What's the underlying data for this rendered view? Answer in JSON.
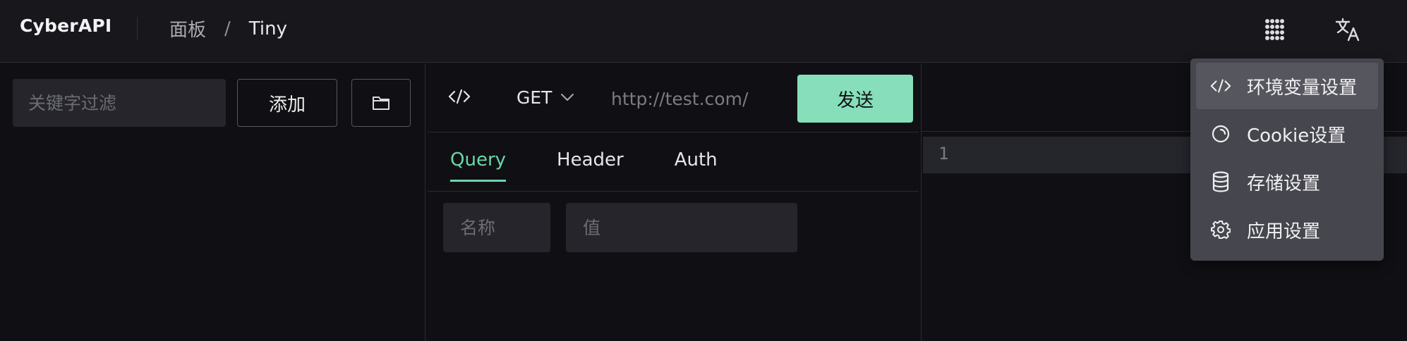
{
  "app": {
    "title": "CyberAPI"
  },
  "breadcrumb": {
    "items": [
      "面板",
      "Tiny"
    ],
    "separator": "/"
  },
  "topbar": {
    "apps_icon": "grid-apps-icon",
    "language_icon": "translate-icon"
  },
  "left": {
    "filter_placeholder": "关键字过滤",
    "add_label": "添加",
    "folder_icon": "folder-icon"
  },
  "request": {
    "code_icon": "code-icon",
    "method": "GET",
    "url_placeholder": "http://test.com/",
    "send_label": "发送",
    "tabs": [
      "Query",
      "Header",
      "Auth"
    ],
    "active_tab": "Query",
    "param_name_placeholder": "名称",
    "param_value_placeholder": "值"
  },
  "editor": {
    "line_numbers": [
      "1"
    ]
  },
  "menu": {
    "items": [
      {
        "label": "环境变量设置",
        "icon": "code-icon"
      },
      {
        "label": "Cookie设置",
        "icon": "cookie-icon"
      },
      {
        "label": "存储设置",
        "icon": "database-icon"
      },
      {
        "label": "应用设置",
        "icon": "gear-icon"
      }
    ]
  },
  "colors": {
    "accent": "#6ad6a8",
    "send_button": "#86dfba",
    "background": "#101014",
    "menu_background": "#46464e"
  }
}
